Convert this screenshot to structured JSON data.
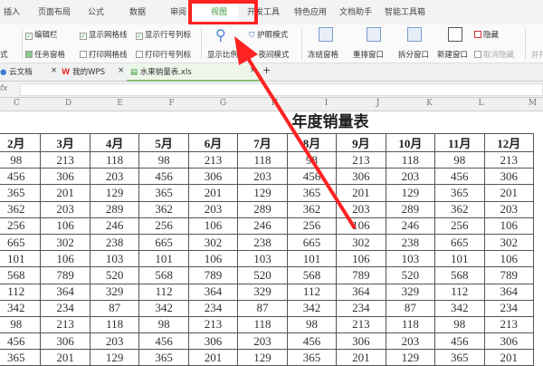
{
  "menu": {
    "tabs": [
      "插入",
      "页面布局",
      "公式",
      "数据",
      "审阅",
      "视图",
      "开发工具",
      "特色应用",
      "文档助手",
      "智能工具箱"
    ],
    "active": "视图"
  },
  "ribbon": {
    "style_label": "式",
    "edit_bar": "编辑栏",
    "task_pane": "任务窗格",
    "show_gridlines": "显示网格线",
    "print_gridlines": "打印网格线",
    "show_headers": "显示行号列标",
    "print_headers": "打印行号列标",
    "zoom": "显示比例",
    "eye_mode": "护眼模式",
    "night_mode": "夜间模式",
    "freeze": "冻结窗格",
    "arrange": "重排窗口",
    "split": "拆分窗口",
    "new_window": "新建窗口",
    "hide": "隐藏",
    "unhide": "取消隐藏",
    "side_by_side": "并排"
  },
  "doc_tabs": [
    "云文档",
    "我的WPS",
    "水果销量表.xls"
  ],
  "formula_bar": {
    "fx": "fx",
    "value": ""
  },
  "columns": [
    "C",
    "D",
    "E",
    "F",
    "G",
    "H",
    "I",
    "J",
    "K",
    "L",
    "M"
  ],
  "sheet": {
    "title": "年度销量表",
    "months": [
      "2月",
      "3月",
      "4月",
      "5月",
      "6月",
      "7月",
      "8月",
      "9月",
      "10月",
      "11月",
      "12月"
    ],
    "rows": [
      [
        98,
        213,
        118,
        98,
        213,
        118,
        98,
        213,
        118,
        98,
        213
      ],
      [
        456,
        306,
        203,
        456,
        306,
        203,
        456,
        306,
        203,
        456,
        306
      ],
      [
        365,
        201,
        129,
        365,
        201,
        129,
        365,
        201,
        129,
        365,
        201
      ],
      [
        362,
        203,
        289,
        362,
        203,
        289,
        362,
        203,
        289,
        362,
        203
      ],
      [
        256,
        106,
        246,
        256,
        106,
        246,
        256,
        106,
        246,
        256,
        106
      ],
      [
        665,
        302,
        238,
        665,
        302,
        238,
        665,
        302,
        238,
        665,
        302
      ],
      [
        101,
        106,
        103,
        101,
        106,
        103,
        101,
        106,
        103,
        101,
        106
      ],
      [
        568,
        789,
        520,
        568,
        789,
        520,
        568,
        789,
        520,
        568,
        789
      ],
      [
        112,
        364,
        329,
        112,
        364,
        329,
        112,
        364,
        329,
        112,
        364
      ],
      [
        342,
        234,
        87,
        342,
        234,
        87,
        342,
        234,
        87,
        342,
        234
      ],
      [
        98,
        213,
        118,
        98,
        213,
        118,
        98,
        213,
        118,
        98,
        213
      ],
      [
        456,
        306,
        203,
        456,
        306,
        203,
        456,
        306,
        203,
        456,
        306
      ],
      [
        365,
        201,
        129,
        365,
        201,
        129,
        365,
        201,
        129,
        365,
        201
      ]
    ]
  },
  "colors": {
    "annotation": "#ff2222",
    "active_doc_tab": "#eef6ea"
  }
}
